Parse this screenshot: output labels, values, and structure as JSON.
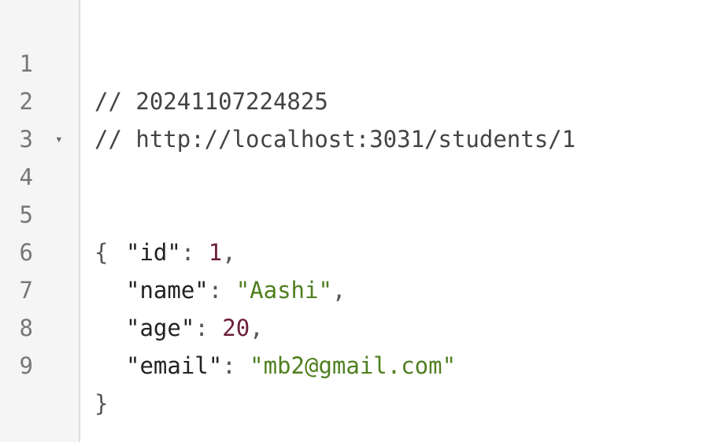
{
  "gutter": {
    "line_numbers": [
      "1",
      "2",
      "3",
      "4",
      "5",
      "6",
      "7",
      "8",
      "9"
    ],
    "fold_toggle": "▾"
  },
  "comments": {
    "timestamp": "// 20241107224825",
    "url": "// http://localhost:3031/students/1"
  },
  "json": {
    "open_brace": "{",
    "close_brace": "}",
    "fields": [
      {
        "key": "\"id\"",
        "value": "1",
        "type": "number",
        "trailing": ","
      },
      {
        "key": "\"name\"",
        "value": "\"Aashi\"",
        "type": "string",
        "trailing": ","
      },
      {
        "key": "\"age\"",
        "value": "20",
        "type": "number",
        "trailing": ","
      },
      {
        "key": "\"email\"",
        "value": "\"mb2@gmail.com\"",
        "type": "string",
        "trailing": ""
      }
    ],
    "colon": ": "
  },
  "colors": {
    "number": "#6b1f3c",
    "string": "#4f7f1f",
    "gutter_bg": "#f5f5f5"
  }
}
